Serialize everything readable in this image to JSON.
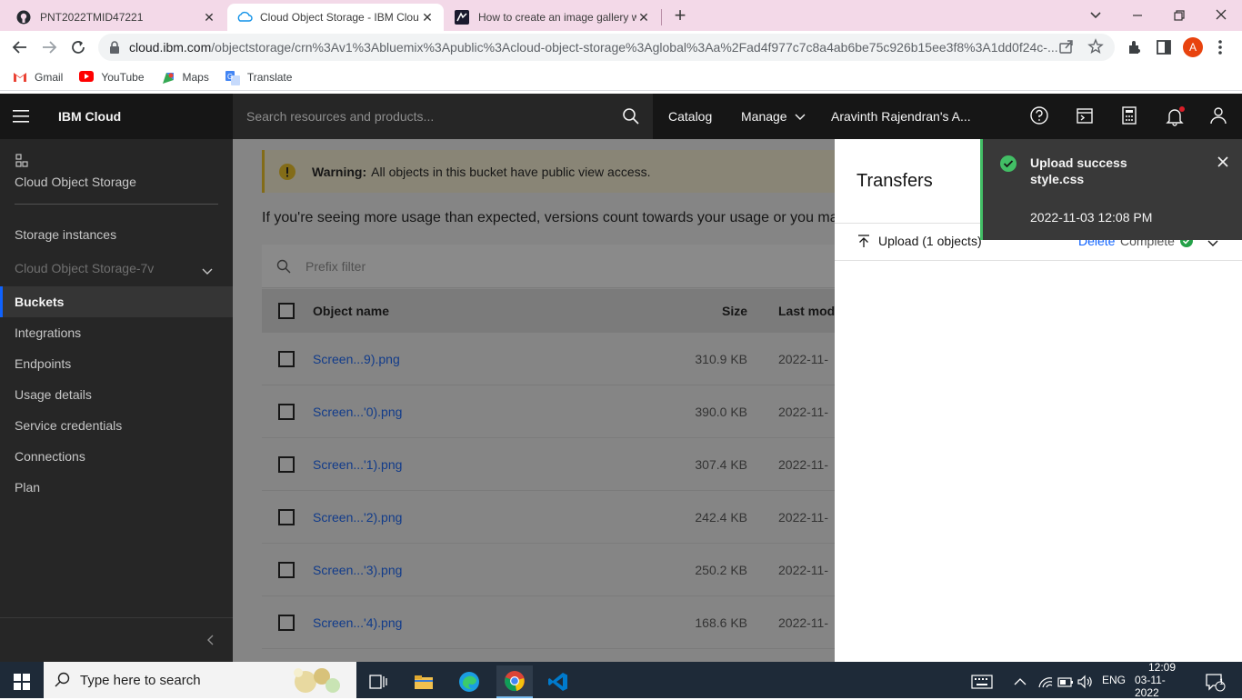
{
  "browser": {
    "tabs": [
      {
        "title": "PNT2022TMID47221",
        "close": "✕"
      },
      {
        "title": "Cloud Object Storage - IBM Clou",
        "close": "✕"
      },
      {
        "title": "How to create an image gallery w",
        "close": "✕"
      }
    ],
    "new_tab": "+",
    "url_host": "cloud.ibm.com",
    "url_path": "/objectstorage/crn%3Av1%3Abluemix%3Apublic%3Acloud-object-storage%3Aglobal%3Aa%2Fad4f977c7c8a4ab6be75c926b15ee3f8%3A1dd0f24c-...",
    "profile_initial": "A",
    "bookmarks": [
      {
        "label": "Gmail",
        "icon": "gmail-icon"
      },
      {
        "label": "YouTube",
        "icon": "youtube-icon"
      },
      {
        "label": "Maps",
        "icon": "maps-icon"
      },
      {
        "label": "Translate",
        "icon": "translate-icon"
      }
    ]
  },
  "header": {
    "brand": "IBM Cloud",
    "search_placeholder": "Search resources and products...",
    "catalog": "Catalog",
    "manage": "Manage",
    "account": "Aravinth Rajendran's A..."
  },
  "sidebar": {
    "service_title": "Cloud Object Storage",
    "storage_instances": "Storage instances",
    "instance_name": "Cloud Object Storage-7v",
    "items": [
      {
        "label": "Buckets",
        "active": true
      },
      {
        "label": "Integrations",
        "active": false
      },
      {
        "label": "Endpoints",
        "active": false
      },
      {
        "label": "Usage details",
        "active": false
      },
      {
        "label": "Service credentials",
        "active": false
      },
      {
        "label": "Connections",
        "active": false
      },
      {
        "label": "Plan",
        "active": false
      }
    ]
  },
  "main": {
    "warning_bold": "Warning:",
    "warning_text": "All objects in this bucket have public view access.",
    "usage_text": "If you're seeing more usage than expected, versions count towards your usage or you ma",
    "prefix_placeholder": "Prefix filter",
    "columns": {
      "name": "Object name",
      "size": "Size",
      "modified": "Last modi"
    },
    "rows": [
      {
        "name": "Screen...9).png",
        "size": "310.9 KB",
        "date": "2022-11-"
      },
      {
        "name": "Screen...'0).png",
        "size": "390.0 KB",
        "date": "2022-11-"
      },
      {
        "name": "Screen...'1).png",
        "size": "307.4 KB",
        "date": "2022-11-"
      },
      {
        "name": "Screen...'2).png",
        "size": "242.4 KB",
        "date": "2022-11-"
      },
      {
        "name": "Screen...'3).png",
        "size": "250.2 KB",
        "date": "2022-11-"
      },
      {
        "name": "Screen...'4).png",
        "size": "168.6 KB",
        "date": "2022-11-"
      }
    ]
  },
  "transfers": {
    "title": "Transfers",
    "upload_label": "Upload (1 objects)",
    "delete": "Delete",
    "status": "Complete"
  },
  "toast": {
    "title": "Upload success",
    "file": "style.css",
    "timestamp": "2022-11-03 12:08 PM"
  },
  "taskbar": {
    "search_placeholder": "Type here to search",
    "lang": "ENG",
    "time": "12:09",
    "date": "03-11-2022",
    "notif_count": "1"
  },
  "colors": {
    "ibm_blue": "#0f62fe",
    "success_green": "#42be65",
    "warning_yellow": "#f1c21b",
    "notification_red": "#da1e28"
  }
}
